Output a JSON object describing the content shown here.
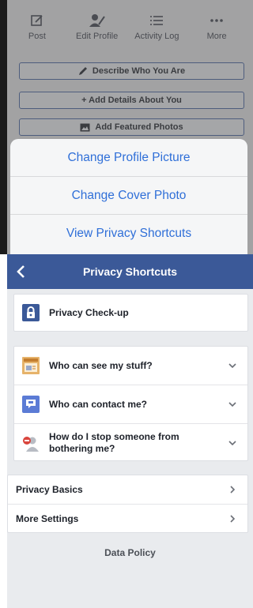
{
  "profile_toolbar": {
    "post": "Post",
    "edit_profile": "Edit Profile",
    "activity_log": "Activity Log",
    "more": "More"
  },
  "profile_buttons": {
    "describe": "Describe Who You Are",
    "add_details": "+ Add Details About You",
    "add_photos": "Add Featured Photos"
  },
  "action_sheet": {
    "items": [
      "Change Profile Picture",
      "Change Cover Photo",
      "View Privacy Shortcuts"
    ]
  },
  "header": {
    "title": "Privacy Shortcuts"
  },
  "privacy_checkup": {
    "label": "Privacy Check-up"
  },
  "shortcuts": [
    {
      "label": "Who can see my stuff?",
      "icon": "stuff-icon"
    },
    {
      "label": "Who can contact me?",
      "icon": "contact-icon"
    },
    {
      "label_line1": "How do I stop someone from",
      "label_line2": "bothering me?",
      "icon": "block-person-icon"
    }
  ],
  "settings_links": {
    "privacy_basics": "Privacy Basics",
    "more_settings": "More Settings"
  },
  "footer": {
    "data_policy": "Data Policy"
  },
  "colors": {
    "brand": "#3b5998",
    "action_text": "#2f6fd8"
  }
}
